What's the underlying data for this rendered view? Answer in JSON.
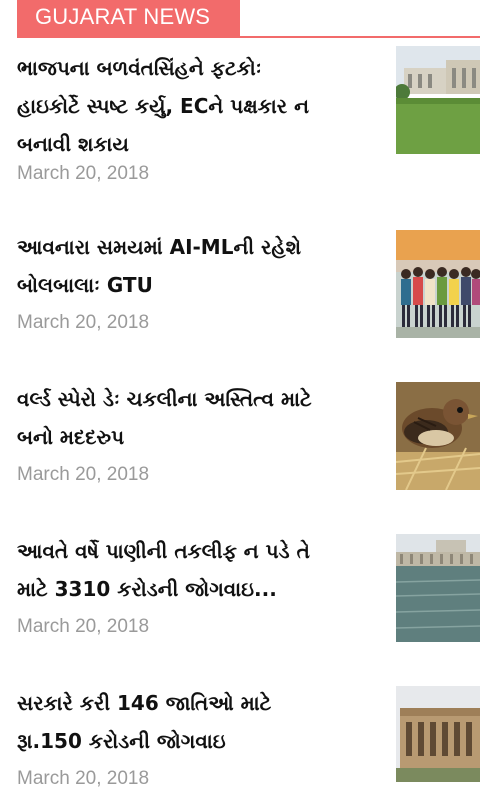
{
  "section": {
    "title": "GUJARAT NEWS"
  },
  "articles": [
    {
      "title_lines": [
        "ભાજપના બળવંતસિંહને ફટકોઃ",
        "હાઇકોર્ટે સ્પષ્ટ કર્યુ, ECને પક્ષકાર ન",
        "બનાવી શકાય"
      ],
      "date": "March 20, 2018",
      "thumbnail": "high-court-building"
    },
    {
      "title_lines": [
        "આવનારા સમયમાં AI-MLની રહેશે",
        "બોલબાલાઃ GTU"
      ],
      "date": "March 20, 2018",
      "thumbnail": "students-group-photo"
    },
    {
      "title_lines": [
        "વર્લ્ડ સ્પેરો ડેઃ ચકલીના અસ્તિત્વ માટે",
        "બનો મદદરુપ"
      ],
      "date": "March 20, 2018",
      "thumbnail": "sparrow-nest"
    },
    {
      "title_lines": [
        "આવતે વર્ષે પાણીની તકલીફ ન પડે તે",
        "માટે 3310 કરોડની જોગવાઇ..."
      ],
      "date": "March 20, 2018",
      "thumbnail": "dam-water"
    },
    {
      "title_lines": [
        "સરકારે કરી 146 જાતિઓ માટે",
        "રૂા.150 કરોડની જોગવાઇ"
      ],
      "date": "March 20, 2018",
      "thumbnail": "government-building"
    }
  ],
  "colors": {
    "accent": "#f26b6b",
    "title": "#111111",
    "date": "#9a9a9a"
  }
}
